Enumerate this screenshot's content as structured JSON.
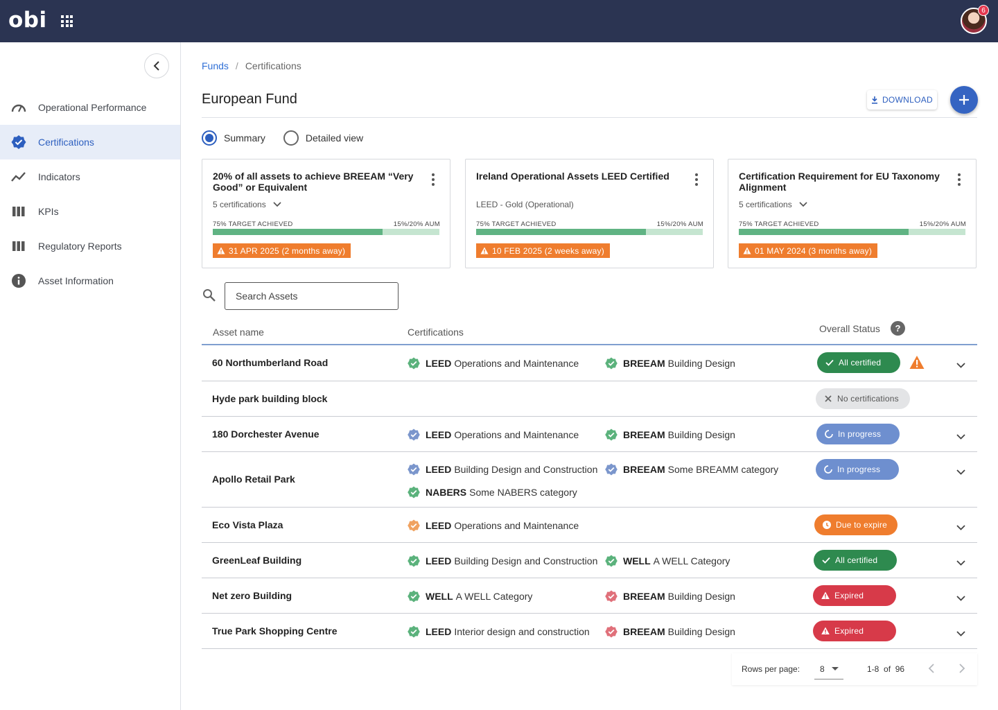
{
  "app": {
    "logo_text": "obi",
    "notification_count": "6"
  },
  "sidebar": {
    "items": [
      {
        "label": "Operational Performance",
        "icon": "gauge-icon"
      },
      {
        "label": "Certifications",
        "icon": "badge-check-icon",
        "active": true
      },
      {
        "label": "Indicators",
        "icon": "trend-line-icon"
      },
      {
        "label": "KPIs",
        "icon": "columns-icon"
      },
      {
        "label": "Regulatory Reports",
        "icon": "columns-icon"
      },
      {
        "label": "Asset Information",
        "icon": "info-icon"
      }
    ]
  },
  "breadcrumb": {
    "root": "Funds",
    "separator": "/",
    "current": "Certifications"
  },
  "page": {
    "title": "European Fund",
    "download_label": "DOWNLOAD"
  },
  "view_toggle": {
    "summary_label": "Summary",
    "detailed_label": "Detailed view",
    "selected": "Summary"
  },
  "cards": [
    {
      "title": "20% of all assets to achieve BREEAM “Very Good” or Equivalent",
      "subtitle": "5 certifications",
      "has_dropdown": true,
      "target_label": "75% TARGET ACHIEVED",
      "aum_label": "15%/20% AUM",
      "progress": 0.75,
      "deadline": "31 APR 2025 (2 months away)"
    },
    {
      "title": "Ireland Operational Assets LEED Certified",
      "subtitle": "LEED - Gold (Operational)",
      "has_dropdown": false,
      "target_label": "75% TARGET ACHIEVED",
      "aum_label": "15%/20% AUM",
      "progress": 0.75,
      "deadline": "10 FEB 2025 (2 weeks away)"
    },
    {
      "title": "Certification Requirement for EU Taxonomy Alignment",
      "subtitle": "5 certifications",
      "has_dropdown": true,
      "target_label": "75% TARGET ACHIEVED",
      "aum_label": "15%/20% AUM",
      "progress": 0.75,
      "deadline": "01 MAY 2024 (3 months away)"
    }
  ],
  "search": {
    "placeholder": "Search Assets"
  },
  "table": {
    "columns": {
      "asset": "Asset name",
      "certifications": "Certifications",
      "status": "Overall Status",
      "help": "?"
    },
    "rows": [
      {
        "name": "60 Northumberland Road",
        "certs": [
          {
            "scheme": "LEED",
            "category": "Operations and Maintenance",
            "state": "certified"
          },
          {
            "scheme": "BREEAM",
            "category": "Building Design",
            "state": "certified"
          }
        ],
        "status": "All certified",
        "status_kind": "green",
        "warning": true,
        "expandable": true
      },
      {
        "name": "Hyde park building block",
        "certs": [],
        "status": "No certifications",
        "status_kind": "grey",
        "expandable": false
      },
      {
        "name": "180 Dorchester Avenue",
        "certs": [
          {
            "scheme": "LEED",
            "category": "Operations and Maintenance",
            "state": "progress"
          },
          {
            "scheme": "BREEAM",
            "category": "Building Design",
            "state": "certified"
          }
        ],
        "status": "In progress",
        "status_kind": "blue",
        "expandable": true
      },
      {
        "name": "Apollo Retail Park",
        "certs": [
          {
            "scheme": "LEED",
            "category": "Building Design and Construction",
            "state": "progress"
          },
          {
            "scheme": "BREEAM",
            "category": "Some BREAMM category",
            "state": "progress"
          },
          {
            "scheme": "NABERS",
            "category": "Some NABERS category",
            "state": "certified"
          }
        ],
        "status": "In progress",
        "status_kind": "blue",
        "expandable": true
      },
      {
        "name": "Eco Vista Plaza",
        "certs": [
          {
            "scheme": "LEED",
            "category": "Operations and Maintenance",
            "state": "expiring"
          }
        ],
        "status": "Due to expire",
        "status_kind": "orange",
        "expandable": true
      },
      {
        "name": "GreenLeaf Building",
        "certs": [
          {
            "scheme": "LEED",
            "category": "Building Design and Construction",
            "state": "certified"
          },
          {
            "scheme": "WELL",
            "category": "A WELL Category",
            "state": "certified"
          }
        ],
        "status": "All certified",
        "status_kind": "green",
        "expandable": true
      },
      {
        "name": "Net zero Building",
        "certs": [
          {
            "scheme": "WELL",
            "category": "A WELL Category",
            "state": "certified"
          },
          {
            "scheme": "BREEAM",
            "category": "Building Design",
            "state": "expired"
          }
        ],
        "status": "Expired",
        "status_kind": "red",
        "expandable": true
      },
      {
        "name": "True Park Shopping Centre",
        "certs": [
          {
            "scheme": "LEED",
            "category": "Interior design and construction",
            "state": "certified"
          },
          {
            "scheme": "BREEAM",
            "category": "Building Design",
            "state": "expired"
          }
        ],
        "status": "Expired",
        "status_kind": "red",
        "expandable": true
      }
    ]
  },
  "pagination": {
    "rows_per_page_label": "Rows per page:",
    "rows_per_page": "8",
    "range": "1-8",
    "of_label": "of",
    "total": "96"
  },
  "colors": {
    "topbar": "#2b3452",
    "accent": "#2d5fbf",
    "certified": "#5bb27c",
    "progress": "#7b96cc",
    "expiring": "#f0a260",
    "expired": "#e0707a",
    "deadline": "#ef7d2e"
  }
}
